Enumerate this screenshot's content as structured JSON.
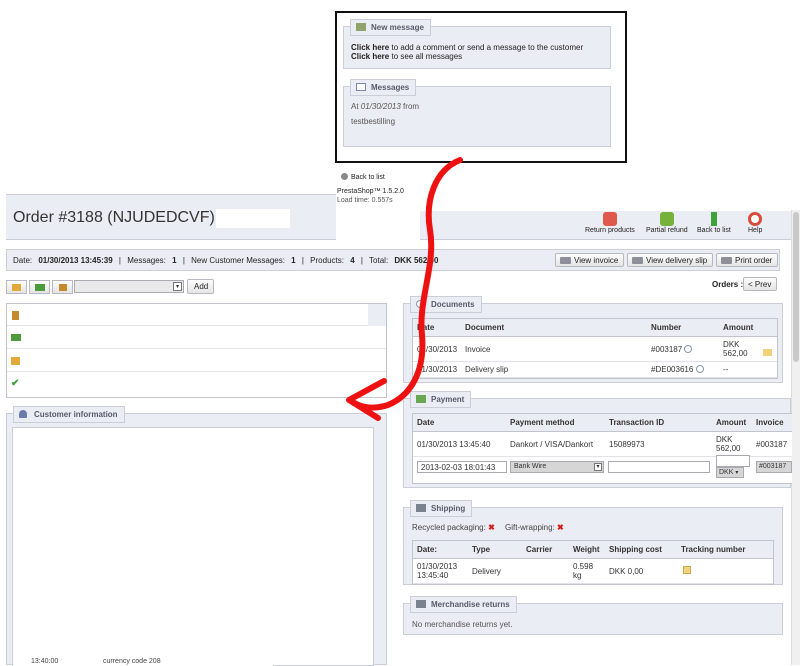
{
  "popup": {
    "new_message_legend": "New message",
    "click_here_1": "Click here",
    "comment_text": " to add a comment or send a message to the customer",
    "click_here_2": "Click here",
    "see_all_text": " to see all messages",
    "messages_legend": "Messages",
    "at_label": "At ",
    "at_date": "01/30/2013",
    "from_label": " from",
    "message_body": "testbestilling"
  },
  "footer": {
    "back_to_list": "Back to list",
    "version": "PrestaShop™ 1.5.2.0",
    "load_time": "Load time: 0.557s"
  },
  "header": {
    "order_title": "Order #3188 (NJUDEDCVF) -",
    "toolbar": [
      {
        "label": "Return products",
        "color": "#e0584b"
      },
      {
        "label": "Partial refund",
        "color": "#74b23a"
      },
      {
        "label": "Back to list",
        "color": "#3fa33c"
      },
      {
        "label": "Help",
        "color": "#d94b3a"
      }
    ]
  },
  "infobar": {
    "date_label": "Date:",
    "date_value": "01/30/2013 13:45:39",
    "messages_label": "Messages:",
    "messages_value": "1",
    "new_msgs_label": "New Customer Messages:",
    "new_msgs_value": "1",
    "products_label": "Products:",
    "products_value": "4",
    "total_label": "Total:",
    "total_value": "DKK 562,00",
    "view_invoice": "View invoice",
    "view_delivery": "View delivery slip",
    "print_order": "Print order"
  },
  "status": {
    "add_button": "Add",
    "orders_label": "Orders :",
    "prev_button": "< Prev"
  },
  "customer": {
    "legend": "Customer information",
    "row_time": "13:40:00",
    "row_text": "currency code 208"
  },
  "documents": {
    "legend": "Documents",
    "headers": [
      "Date",
      "Document",
      "Number",
      "Amount"
    ],
    "rows": [
      {
        "date": "01/30/2013",
        "document": "Invoice",
        "number": "#003187",
        "amount": "DKK 562,00"
      },
      {
        "date": "01/30/2013",
        "document": "Delivery slip",
        "number": "#DE003616",
        "amount": "--"
      }
    ]
  },
  "payment": {
    "legend": "Payment",
    "headers": [
      "Date",
      "Payment method",
      "Transaction ID",
      "Amount",
      "Invoice"
    ],
    "row": {
      "date": "01/30/2013 13:45:40",
      "method": "Dankort / VISA/Dankort",
      "transaction": "15089973",
      "amount": "DKK 562,00",
      "invoice": "#003187"
    },
    "new_date": "2013-02-03 18:01:43",
    "new_method": "Bank Wire",
    "new_currency": "DKK",
    "new_invoice": "#003187"
  },
  "shipping": {
    "legend": "Shipping",
    "recycled_label": "Recycled packaging:",
    "gift_label": "Gift-wrapping:",
    "headers": [
      "Date:",
      "Type",
      "Carrier",
      "Weight",
      "Shipping cost",
      "Tracking number"
    ],
    "row": {
      "date": "01/30/2013 13:45:40",
      "type": "Delivery",
      "carrier": "",
      "weight": "0.598 kg",
      "cost": "DKK 0,00"
    }
  },
  "returns": {
    "legend": "Merchandise returns",
    "empty_text": "No merchandise returns yet."
  },
  "colors": {
    "annotation_red": "#ee1111",
    "panel_bg": "#ebedf4",
    "border": "#ccced7"
  }
}
